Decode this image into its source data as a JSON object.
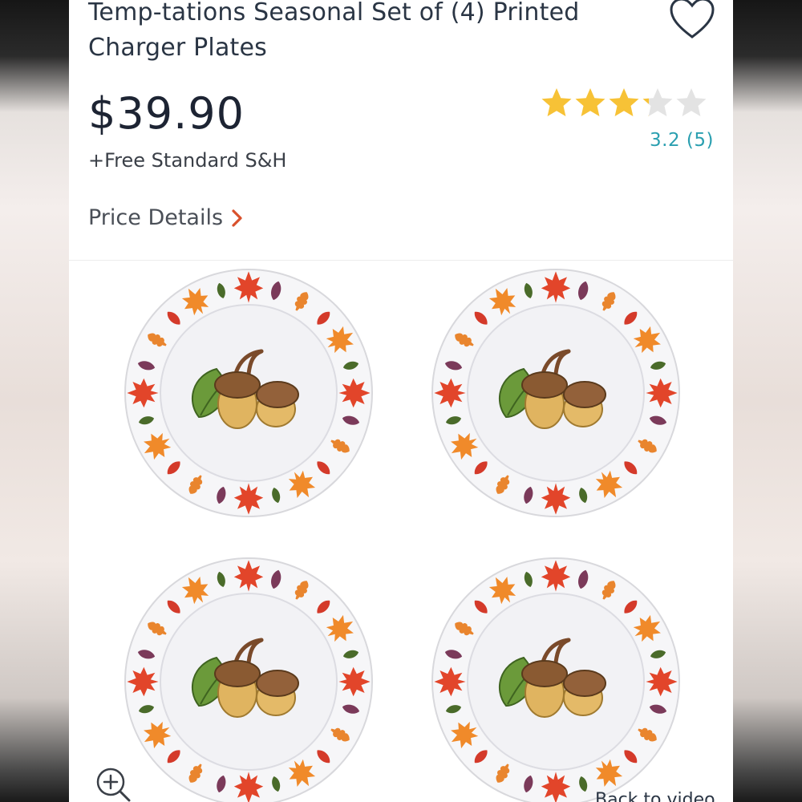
{
  "product": {
    "title": "Temp-tations Seasonal Set of (4) Printed Charger Plates",
    "price": "$39.90",
    "shipping": "+Free Standard S&H",
    "rating_text": "3.2 (5)",
    "rating_value": 3.2,
    "rating_max": 5
  },
  "actions": {
    "favorite_icon": "heart-outline-icon",
    "price_details_label": "Price Details",
    "zoom_icon": "zoom-in-icon",
    "back_to_video_label": "Back to video"
  },
  "colors": {
    "star_filled": "#f7c236",
    "star_empty": "#e3e3e3",
    "price_details_chevron": "#d9512c",
    "rating_link": "#2a9fb0"
  }
}
